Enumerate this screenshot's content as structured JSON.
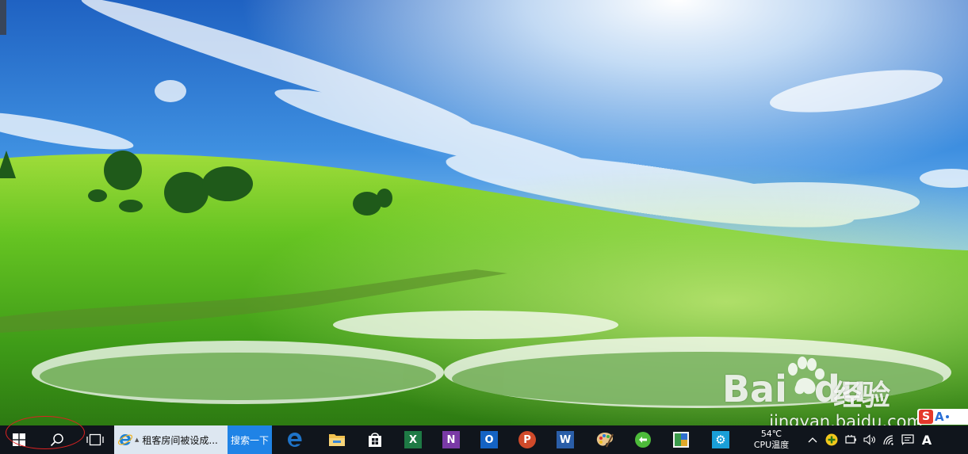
{
  "desktop": {
    "wallpaper": "green meadow with blue sky",
    "watermark_logo": "Bai",
    "watermark_logo_tail": "du",
    "watermark_jingyan": "经验",
    "watermark_url": "jingyan.baidu.com",
    "ime_badge": {
      "s": "S",
      "a": "A"
    }
  },
  "taskbar": {
    "start_icon": "windows-logo-icon",
    "search_icon": "search-icon",
    "taskview_icon": "task-view-icon",
    "ie_task_title": "租客房间被设成...",
    "search_task_label": "搜索一下",
    "apps": [
      {
        "name": "edge",
        "icon": "edge-icon",
        "color": "#1e73c8"
      },
      {
        "name": "file-explorer",
        "icon": "folder-icon",
        "color": "#f2c14e"
      },
      {
        "name": "store",
        "icon": "store-icon",
        "color": "#ffffff"
      },
      {
        "name": "excel",
        "icon": "excel-icon",
        "color": "#1e7a45",
        "letter": "X"
      },
      {
        "name": "onenote",
        "icon": "onenote-icon",
        "color": "#7a3aa6",
        "letter": "N"
      },
      {
        "name": "outlook",
        "icon": "outlook-icon",
        "color": "#1463c3",
        "letter": "O"
      },
      {
        "name": "powerpoint",
        "icon": "powerpoint-icon",
        "color": "#d04a2a",
        "letter": "P"
      },
      {
        "name": "word",
        "icon": "word-icon",
        "color": "#2a5ea8",
        "letter": "W"
      },
      {
        "name": "paint",
        "icon": "palette-icon",
        "color": "#e8b04a"
      },
      {
        "name": "sync",
        "icon": "green-circle-icon",
        "color": "#4dbb3a"
      },
      {
        "name": "gallery",
        "icon": "gallery-icon",
        "color": "#5aa86a"
      },
      {
        "name": "settings",
        "icon": "gear-icon",
        "color": "#1a9fd8"
      }
    ],
    "tray": {
      "temperature": "54℃",
      "temperature_label": "CPU温度",
      "ime_indicator": "A"
    }
  }
}
